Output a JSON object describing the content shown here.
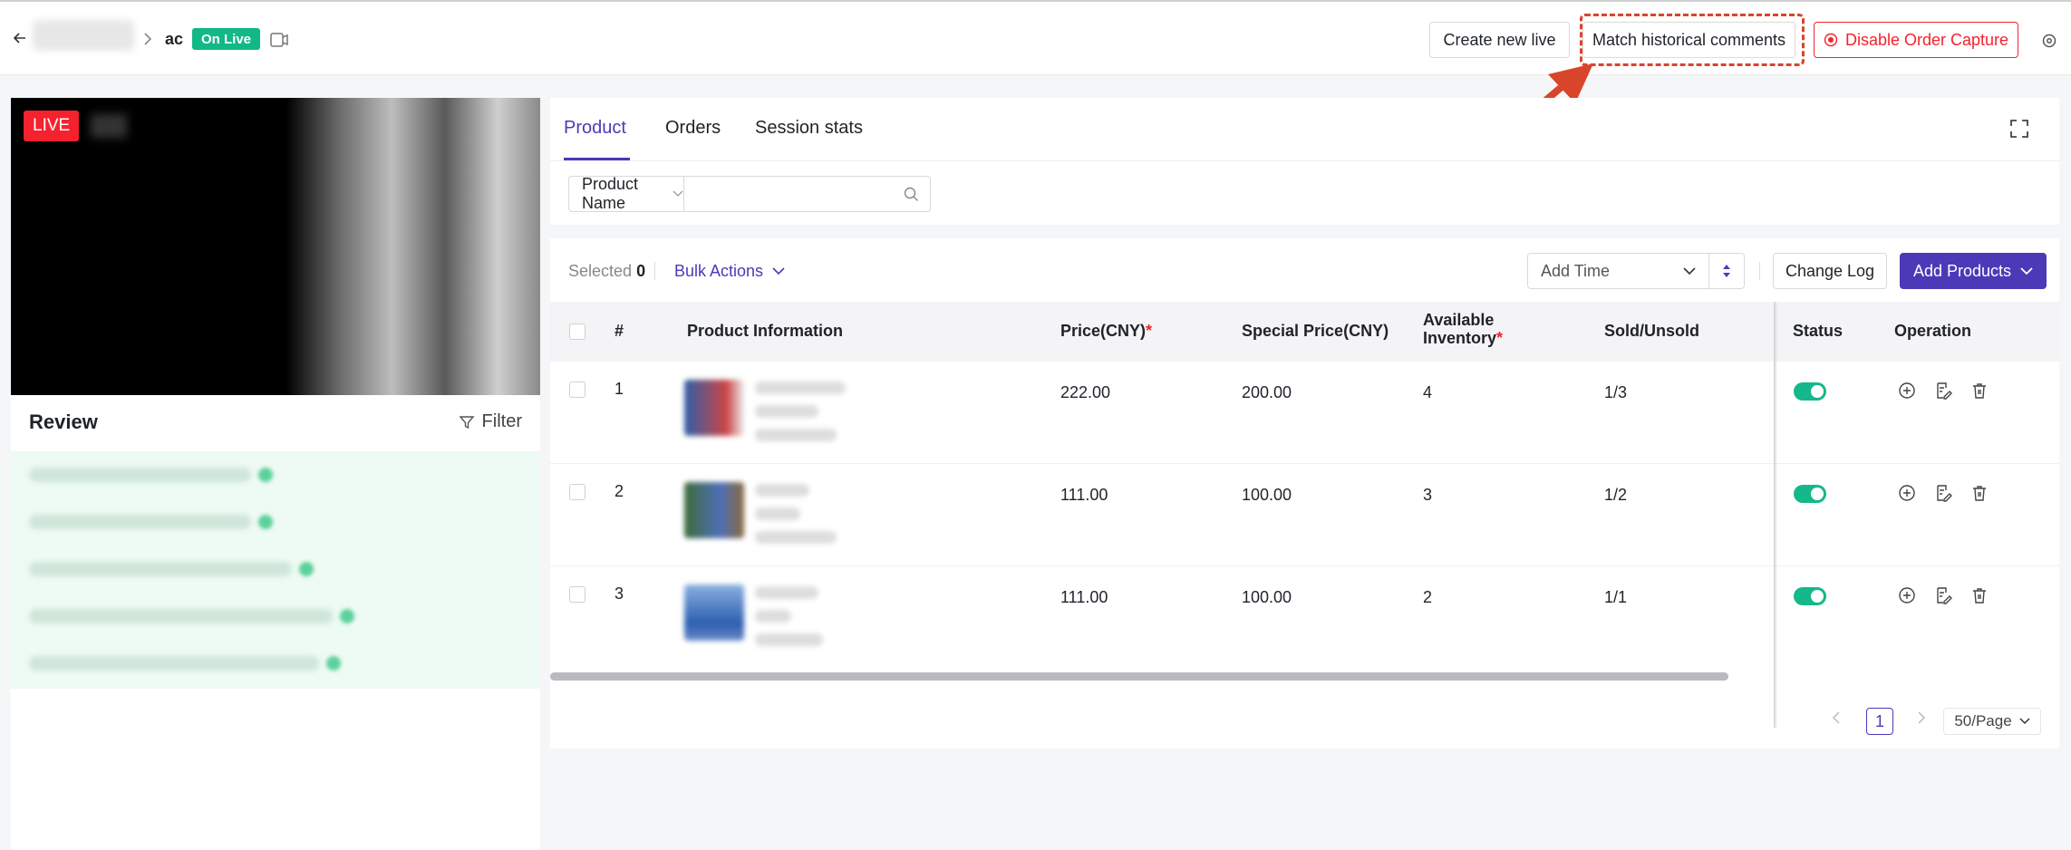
{
  "header": {
    "title_blur": "",
    "live_name": "ac",
    "status_badge": "On Live",
    "create_new_live": "Create new live",
    "match_historical": "Match historical comments",
    "disable_order_capture": "Disable Order Capture",
    "colors": {
      "status_green": "#12b886",
      "danger": "#f5222d",
      "accent": "#4a3ab7",
      "highlight": "#d9452b"
    }
  },
  "video": {
    "live_label": "LIVE"
  },
  "review": {
    "title": "Review",
    "filter_label": "Filter"
  },
  "tabs": [
    {
      "label": "Product",
      "active": true
    },
    {
      "label": "Orders",
      "active": false
    },
    {
      "label": "Session stats",
      "active": false
    }
  ],
  "search": {
    "field_select": "Product Name",
    "placeholder": ""
  },
  "toolbar": {
    "selected_label": "Selected",
    "selected_count": "0",
    "bulk_actions": "Bulk Actions",
    "sort_select": "Add Time",
    "change_log": "Change Log",
    "add_products": "Add Products"
  },
  "table": {
    "columns": {
      "index": "#",
      "product_info": "Product Information",
      "price": "Price(CNY)",
      "special_price": "Special Price(CNY)",
      "inventory_line1": "Available",
      "inventory_line2": "Inventory",
      "sold_unsold": "Sold/Unsold",
      "status": "Status",
      "operation": "Operation"
    },
    "rows": [
      {
        "index": "1",
        "price": "222.00",
        "special_price": "200.00",
        "inventory": "4",
        "sold_unsold": "1/3",
        "status_on": true
      },
      {
        "index": "2",
        "price": "111.00",
        "special_price": "100.00",
        "inventory": "3",
        "sold_unsold": "1/2",
        "status_on": true
      },
      {
        "index": "3",
        "price": "111.00",
        "special_price": "100.00",
        "inventory": "2",
        "sold_unsold": "1/1",
        "status_on": true
      }
    ]
  },
  "pagination": {
    "current_page": "1",
    "page_size": "50/Page"
  },
  "icons": [
    "back-arrow-icon",
    "chevron-right-icon",
    "screen-icon",
    "settings-icon",
    "record-icon",
    "expand-icon",
    "search-icon",
    "filter-icon",
    "chevron-down-icon",
    "sort-icon",
    "add-circle-icon",
    "edit-icon",
    "trash-icon"
  ]
}
